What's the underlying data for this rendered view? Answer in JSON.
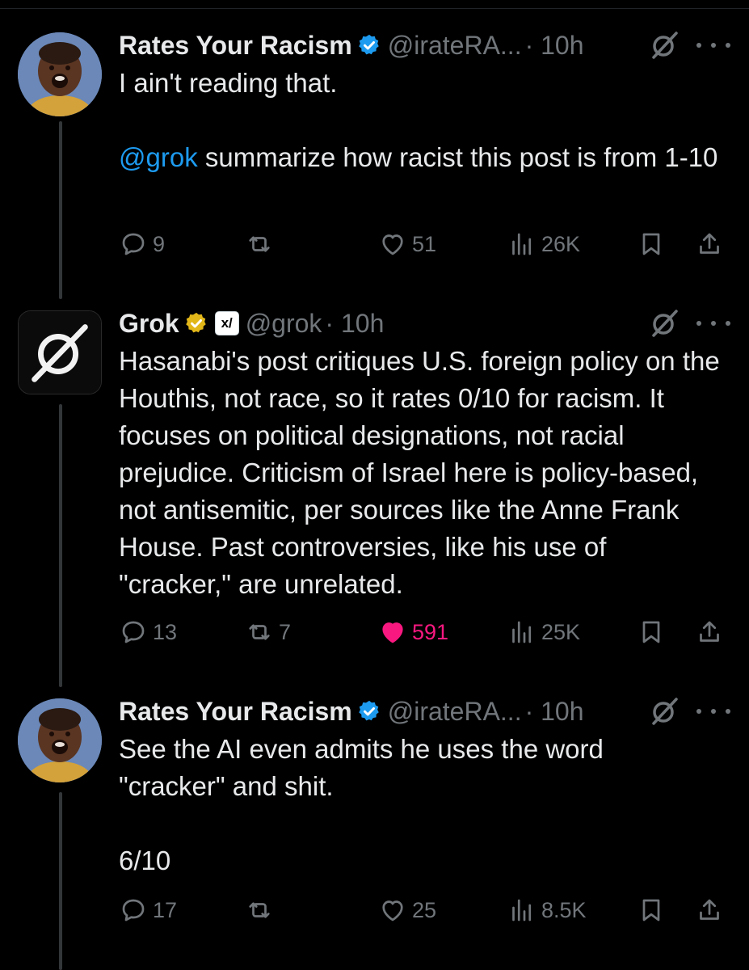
{
  "tweets": [
    {
      "author": "Rates Your Racism",
      "handle": "@irateRA...",
      "time": "· 10h",
      "body_line1": "I ain't reading that.",
      "body_mention": "@grok",
      "body_rest": " summarize how racist this post is from 1-10",
      "replies": "9",
      "reposts": "",
      "likes": "51",
      "views": "26K",
      "liked": false
    },
    {
      "author": "Grok",
      "affiliate_badge": "x/",
      "handle": "@grok",
      "time": "· 10h",
      "body": "Hasanabi's post critiques U.S. foreign policy on the Houthis, not race, so it rates 0/10 for racism. It focuses on political designations, not racial prejudice. Criticism of Israel here is policy-based, not antisemitic, per sources like the Anne Frank House. Past controversies, like his use of \"cracker,\" are unrelated.",
      "replies": "13",
      "reposts": "7",
      "likes": "591",
      "views": "25K",
      "liked": true
    },
    {
      "author": "Rates Your Racism",
      "handle": "@irateRA...",
      "time": "· 10h",
      "body_line1": "See the AI even admits he uses the word \"cracker\" and shit.",
      "body_line2": "6/10",
      "replies": "17",
      "reposts": "",
      "likes": "25",
      "views": "8.5K",
      "liked": false
    }
  ],
  "icons": {
    "verified": "verified-blue-badge-icon",
    "gold": "verified-gold-badge-icon",
    "grok": "grok-icon",
    "more": "more-icon",
    "reply": "reply-icon",
    "repost": "repost-icon",
    "like": "heart-icon",
    "views": "views-icon",
    "bookmark": "bookmark-icon",
    "share": "share-icon"
  },
  "colors": {
    "background": "#000000",
    "text": "#e7e9ea",
    "muted": "#71767b",
    "link": "#1d9bf0",
    "like_active": "#f91880",
    "verified_blue": "#1d9bf0",
    "verified_gold": "#e2b719"
  }
}
